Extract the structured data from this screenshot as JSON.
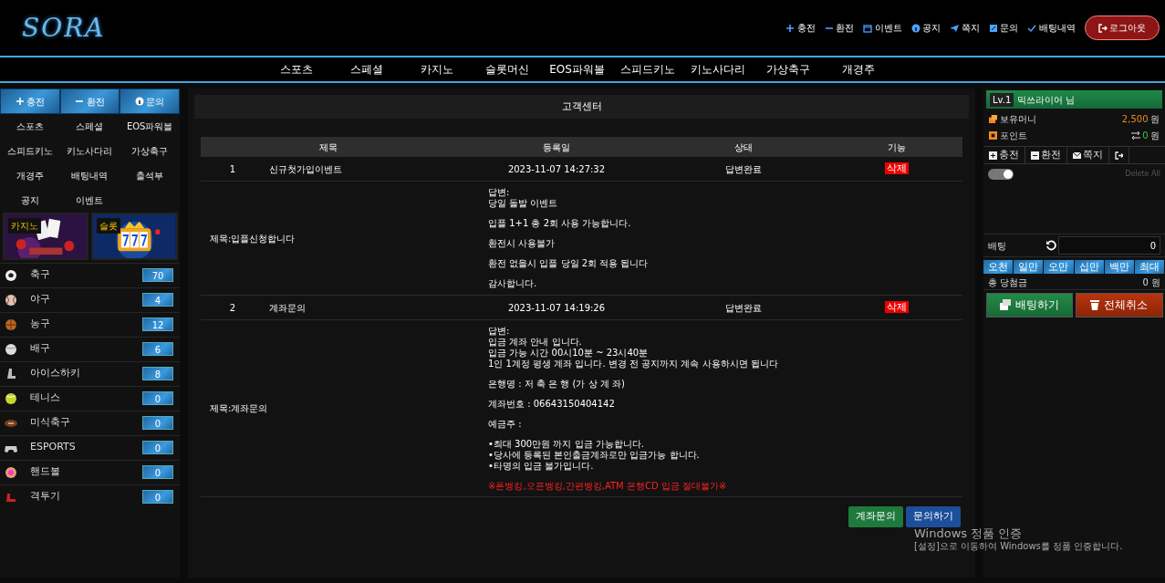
{
  "logo": "SORA",
  "top_links": [
    {
      "kind": "plus",
      "label": "충전"
    },
    {
      "kind": "minus",
      "label": "환전"
    },
    {
      "kind": "calendar",
      "label": "이벤트"
    },
    {
      "kind": "info",
      "label": "공지"
    },
    {
      "kind": "send",
      "label": "쪽지"
    },
    {
      "kind": "edit",
      "label": "문의"
    },
    {
      "kind": "check",
      "label": "배팅내역"
    }
  ],
  "logout_button": "로그아웃",
  "main_nav": [
    "스포츠",
    "스페셜",
    "카지노",
    "슬롯머신",
    "EOS파워볼",
    "스피드키노",
    "키노사다리",
    "가상축구",
    "개경주"
  ],
  "sidebar": {
    "buttons": [
      {
        "kind": "plus",
        "label": "충전"
      },
      {
        "kind": "minus",
        "label": "환전"
      },
      {
        "kind": "info",
        "label": "문의"
      }
    ],
    "menu": [
      "스포츠",
      "스페셜",
      "EOS파워볼",
      "스피드키노",
      "키노사다리",
      "가상축구",
      "개경주",
      "배팅내역",
      "출석부",
      "공지",
      "이벤트"
    ],
    "banners": [
      {
        "label": "카지노"
      },
      {
        "label": "슬롯"
      }
    ],
    "sports": [
      {
        "name": "축구",
        "count": "70"
      },
      {
        "name": "야구",
        "count": "4"
      },
      {
        "name": "농구",
        "count": "12"
      },
      {
        "name": "배구",
        "count": "6"
      },
      {
        "name": "아이스하키",
        "count": "8"
      },
      {
        "name": "테니스",
        "count": "0"
      },
      {
        "name": "미식축구",
        "count": "0"
      },
      {
        "name": "ESPORTS",
        "count": "0"
      },
      {
        "name": "핸드볼",
        "count": "0"
      },
      {
        "name": "격투기",
        "count": "0"
      }
    ]
  },
  "page_title": "고객센터",
  "table": {
    "columns": [
      "제목",
      "등록일",
      "상태",
      "기능"
    ],
    "rows": [
      {
        "no": "1",
        "title": "신규첫가입이벤트",
        "date": "2023-11-07 14:27:32",
        "status": "답변완료",
        "action": "삭제",
        "question": "제목:입플신청합니다",
        "answer": [
          [
            "답변:",
            "당일 돌발 이벤트"
          ],
          [
            "입플 1+1 총 2회 사용 가능합니다."
          ],
          [
            "환전시 사용불가"
          ],
          [
            "환전 없을시 입플 당일 2회 적용 됩니다"
          ],
          [
            "감사합니다."
          ]
        ]
      },
      {
        "no": "2",
        "title": "계좌문의",
        "date": "2023-11-07 14:19:26",
        "status": "답변완료",
        "action": "삭제",
        "question": "제목:계좌문의",
        "answer": [
          [
            "답변:",
            "입금 계좌 안내 입니다.",
            "입금 가능 시간 00시10분 ~ 23시40분",
            "1인 1계정 평생 계좌 입니다. 변경 전 공지까지 계속 사용하시면 됩니다"
          ],
          [
            "은행명 : 저 축 은 행 (가 상 계 좌)"
          ],
          [
            "계좌번호 : 06643150404142"
          ],
          [
            "예금주 :"
          ],
          [
            "•최대 300만원 까지 입금 가능합니다.",
            "•당사에 등록된 본인출금계좌로만 입금가능 합니다.",
            "•타명의 입금 불가입니다."
          ]
        ],
        "warning": "※폰뱅킹,오픈뱅킹,간편뱅킹,ATM 은행CD 입금 절대불가※"
      }
    ]
  },
  "bottom_buttons": [
    {
      "kind": "success",
      "label": "계좌문의"
    },
    {
      "kind": "primary",
      "label": "문의하기"
    }
  ],
  "user_panel": {
    "level": "Lv.1",
    "user": "믹쓰라이어 님",
    "money_label": "보유머니",
    "money": "2,500",
    "money_unit": "원",
    "point_label": "포인트",
    "point": "0",
    "point_unit": "원",
    "tabs": [
      {
        "kind": "plus",
        "label": "충전"
      },
      {
        "kind": "minus",
        "label": "환전"
      },
      {
        "kind": "mail",
        "label": "쪽지"
      },
      {
        "kind": "logout"
      }
    ],
    "toggle": {
      "on": true
    },
    "delete_all": "Delete All",
    "bet_label": "배팅",
    "bet_value": "0",
    "amounts": [
      "오천",
      "일만",
      "오만",
      "십만",
      "백만",
      "최대"
    ],
    "total_label": "총 당첨금",
    "total": "0 원",
    "bet_button": "배팅하기",
    "cancel_button": "전체취소"
  },
  "os_notice": {
    "title": "Windows 정품 인증",
    "text": "[설정]으로 이동하여 Windows를 정품 인증합니다."
  }
}
